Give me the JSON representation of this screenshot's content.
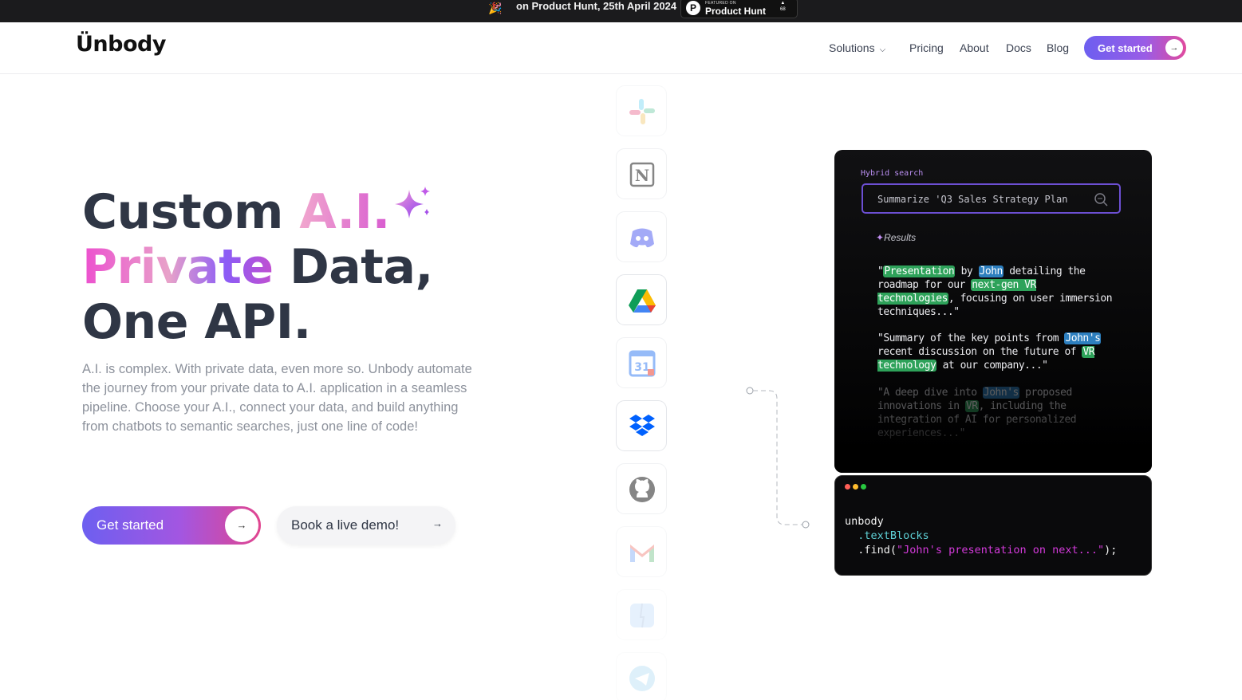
{
  "announcement": {
    "party_icon": "party-popper-icon",
    "text": "on Product Hunt, 25th April 2024",
    "badge": {
      "small": "FEATURED ON",
      "name": "Product Hunt",
      "votes": "68"
    }
  },
  "nav": {
    "logo": "Ünbody",
    "links": [
      "Solutions",
      "Pricing",
      "About",
      "Docs",
      "Blog"
    ],
    "cta": "Get started"
  },
  "hero": {
    "title_line1_a": "Custom ",
    "title_line1_b": "A.I.",
    "title_line2_a": "Private",
    "title_line2_b": " Data,",
    "title_line3": "One API.",
    "description": "A.I. is complex. With private data, even more so. Unbody automate the journey from your private data to A.I. application in a seamless pipeline. Choose your A.I., connect your data, and build anything from chatbots to semantic searches, just one line of code!",
    "primary_button": "Get started",
    "secondary_button": "Book a live demo!"
  },
  "integrations": [
    "slack-icon",
    "notion-icon",
    "discord-icon",
    "google-drive-icon",
    "google-calendar-icon",
    "dropbox-icon",
    "github-icon",
    "gmail-icon",
    "finder-icon",
    "telegram-icon"
  ],
  "search_demo": {
    "label": "Hybrid search",
    "query": "Summarize 'Q3 Sales Strategy Plan",
    "results_label": "Results",
    "result1": {
      "t1": "\"",
      "h1": "Presentation",
      "t2": " by ",
      "h2": "John",
      "t3": " detailing the roadmap for our ",
      "h3": "next-gen VR technologies",
      "t4": ", focusing on user immersion techniques...\""
    },
    "result2": {
      "t1": "\"Summary of the key points from ",
      "h1": "John's",
      "t2": " recent discussion on the future of ",
      "h2": "VR technology",
      "t3": " at our company...\""
    },
    "result3": {
      "t1": "\"A deep dive into ",
      "h1": "John's",
      "t2": " proposed innovations in ",
      "h2": "VR",
      "t3": ", including the integration of AI for personalized experiences...\""
    }
  },
  "code_demo": {
    "line1": "unbody",
    "line2": ".textBlocks",
    "line3_a": ".find(",
    "line3_b": "\"John's presentation on next...\"",
    "line3_c": ");"
  },
  "colors": {
    "brand_gradient_start": "#6d5ff0",
    "brand_gradient_end": "#e1458f",
    "text_dark": "#2f3645",
    "highlight_green": "#2ea25a",
    "highlight_blue": "#2d7fbf"
  }
}
